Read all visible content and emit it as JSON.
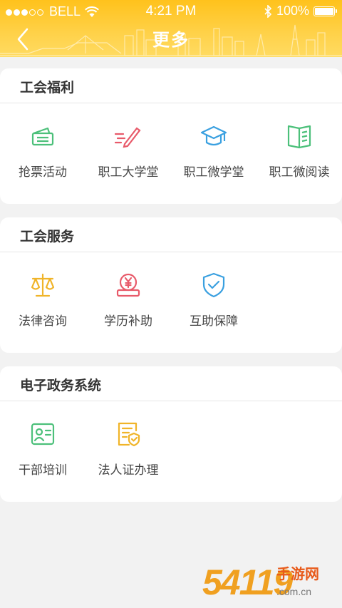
{
  "status_bar": {
    "carrier": "BELL",
    "time": "4:21 PM",
    "battery": "100%"
  },
  "header": {
    "title": "更多"
  },
  "sections": [
    {
      "title": "工会福利",
      "items": [
        {
          "label": "抢票活动",
          "icon": "ticket-icon",
          "color": "#4cc07a"
        },
        {
          "label": "职工大学堂",
          "icon": "pen-icon",
          "color": "#e85a6a"
        },
        {
          "label": "职工微学堂",
          "icon": "graduation-cap-icon",
          "color": "#3aa0e0"
        },
        {
          "label": "职工微阅读",
          "icon": "book-icon",
          "color": "#4cc07a"
        }
      ]
    },
    {
      "title": "工会服务",
      "items": [
        {
          "label": "法律咨询",
          "icon": "scales-icon",
          "color": "#f0b429"
        },
        {
          "label": "学历补助",
          "icon": "yen-coin-icon",
          "color": "#e85a6a"
        },
        {
          "label": "互助保障",
          "icon": "shield-check-icon",
          "color": "#3aa0e0"
        }
      ]
    },
    {
      "title": "电子政务系统",
      "items": [
        {
          "label": "干部培训",
          "icon": "id-card-icon",
          "color": "#4cc07a"
        },
        {
          "label": "法人证办理",
          "icon": "certificate-icon",
          "color": "#f0b429"
        }
      ]
    }
  ],
  "watermark": {
    "brand_number": "54119",
    "brand_text": "手游网",
    "brand_url": ".com.cn"
  }
}
